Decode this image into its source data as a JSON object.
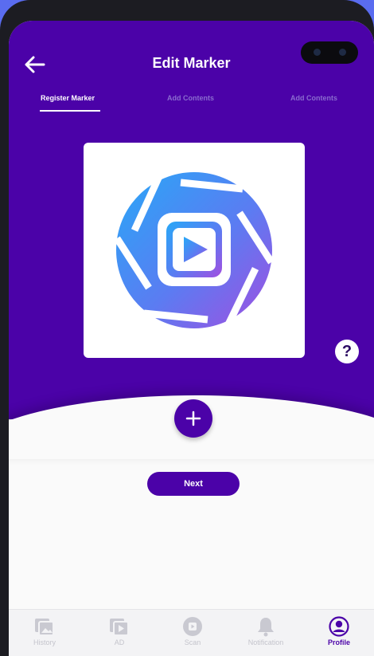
{
  "header": {
    "title": "Edit Marker"
  },
  "tabs": [
    {
      "label": "Register Marker",
      "active": true
    },
    {
      "label": "Add Contents",
      "active": false
    },
    {
      "label": "Add Contents",
      "active": false
    }
  ],
  "help": {
    "label": "?"
  },
  "actions": {
    "next_label": "Next"
  },
  "bottom_nav": [
    {
      "label": "History",
      "icon": "history-icon"
    },
    {
      "label": "AD",
      "icon": "ad-icon"
    },
    {
      "label": "Scan",
      "icon": "scan-icon"
    },
    {
      "label": "Notification",
      "icon": "bell-icon"
    },
    {
      "label": "Profile",
      "icon": "profile-icon",
      "active": true
    }
  ],
  "colors": {
    "primary": "#4b02a8",
    "background": "#fafafa"
  }
}
